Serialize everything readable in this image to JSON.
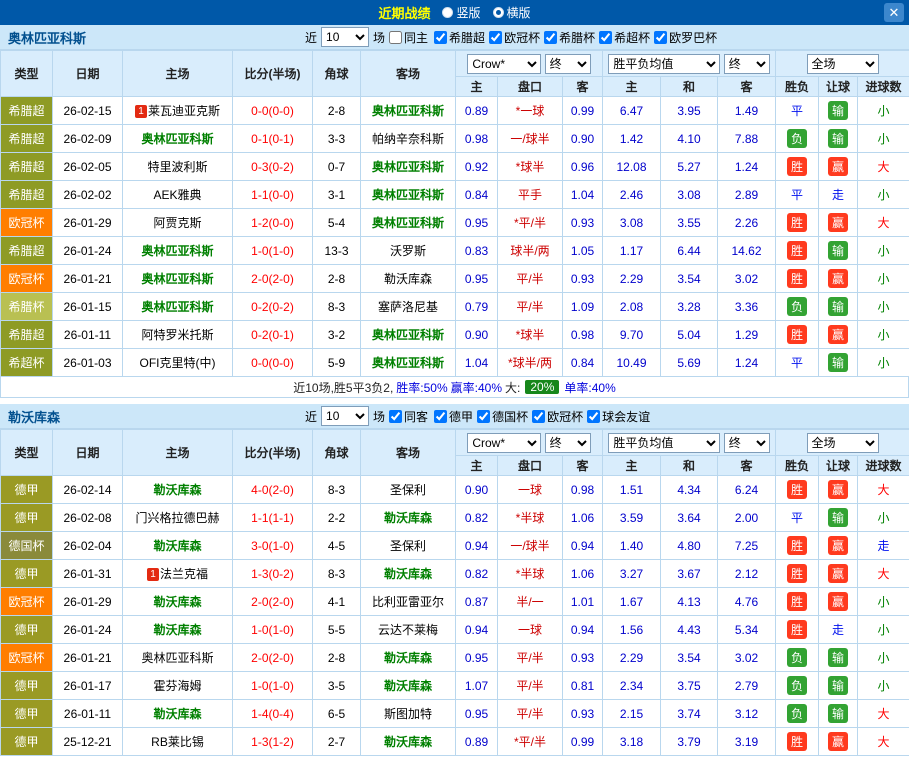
{
  "topbar": {
    "title": "近期战绩",
    "radios": [
      {
        "label": "竖版",
        "checked": false
      },
      {
        "label": "横版",
        "checked": true
      }
    ],
    "close_label": "✕"
  },
  "table_header": {
    "type": "类型",
    "date": "日期",
    "home": "主场",
    "score": "比分(半场)",
    "corner": "角球",
    "away": "客场",
    "asian_home": "主",
    "asian_line": "盘口",
    "asian_away": "客",
    "euro_home": "主",
    "euro_draw": "和",
    "euro_away": "客",
    "result": "胜负",
    "handicap": "让球",
    "goals": "进球数"
  },
  "league_colors": {
    "希腊超": "#8e9b25",
    "希腊杯": "#b9c052",
    "希超杯": "#8e9b25",
    "欧冠杯": "#ff7e00",
    "德甲": "#9a9a24",
    "德国杯": "#8a8a3a"
  },
  "sections": [
    {
      "team": "奥林匹亚科斯",
      "filter": {
        "near_label": "近",
        "count": "10",
        "games_label": "场",
        "same_label": "同主",
        "same_checked": false,
        "leagues": [
          {
            "label": "希腊超",
            "checked": true
          },
          {
            "label": "欧冠杯",
            "checked": true
          },
          {
            "label": "希腊杯",
            "checked": true
          },
          {
            "label": "希超杯",
            "checked": true
          },
          {
            "label": "欧罗巴杯",
            "checked": true
          }
        ]
      },
      "dropdowns": {
        "company": "Crow*",
        "company_time": "终",
        "europe": "胜平负均值",
        "europe_time": "终",
        "scope": "全场"
      },
      "rows": [
        {
          "league": "希腊超",
          "date": "26-02-15",
          "home": "莱瓦迪亚克斯",
          "home_rank": "1",
          "score": "0-0(0-0)",
          "corner": "2-8",
          "away": "奥林匹亚科斯",
          "away_focus": true,
          "asian": {
            "home": "0.89",
            "line": "*一球",
            "away": "0.99"
          },
          "europe": {
            "home": "6.47",
            "draw": "3.95",
            "away": "1.49"
          },
          "result": {
            "text": "平",
            "type": "draw"
          },
          "handicap_result": {
            "text": "输",
            "type": "lose"
          },
          "goals": {
            "text": "小",
            "type": "small"
          }
        },
        {
          "league": "希腊超",
          "date": "26-02-09",
          "home": "奥林匹亚科斯",
          "home_focus": true,
          "score": "0-1(0-1)",
          "corner": "3-3",
          "away": "帕纳辛奈科斯",
          "asian": {
            "home": "0.98",
            "line": "一/球半",
            "away": "0.90"
          },
          "europe": {
            "home": "1.42",
            "draw": "4.10",
            "away": "7.88"
          },
          "result": {
            "text": "负",
            "type": "lose"
          },
          "handicap_result": {
            "text": "输",
            "type": "lose"
          },
          "goals": {
            "text": "小",
            "type": "small"
          }
        },
        {
          "league": "希腊超",
          "date": "26-02-05",
          "home": "特里波利斯",
          "score": "0-3(0-2)",
          "corner": "0-7",
          "away": "奥林匹亚科斯",
          "away_focus": true,
          "asian": {
            "home": "0.92",
            "line": "*球半",
            "away": "0.96"
          },
          "europe": {
            "home": "12.08",
            "draw": "5.27",
            "away": "1.24"
          },
          "result": {
            "text": "胜",
            "type": "win"
          },
          "handicap_result": {
            "text": "赢",
            "type": "win"
          },
          "goals": {
            "text": "大",
            "type": "big"
          }
        },
        {
          "league": "希腊超",
          "date": "26-02-02",
          "home": "AEK雅典",
          "score": "1-1(0-0)",
          "corner": "3-1",
          "away": "奥林匹亚科斯",
          "away_focus": true,
          "asian": {
            "home": "0.84",
            "line": "平手",
            "away": "1.04"
          },
          "europe": {
            "home": "2.46",
            "draw": "3.08",
            "away": "2.89"
          },
          "result": {
            "text": "平",
            "type": "draw"
          },
          "handicap_result": {
            "text": "走",
            "type": "push"
          },
          "goals": {
            "text": "小",
            "type": "small"
          }
        },
        {
          "league": "欧冠杯",
          "date": "26-01-29",
          "home": "阿贾克斯",
          "score": "1-2(0-0)",
          "corner": "5-4",
          "away": "奥林匹亚科斯",
          "away_focus": true,
          "asian": {
            "home": "0.95",
            "line": "*平/半",
            "away": "0.93"
          },
          "europe": {
            "home": "3.08",
            "draw": "3.55",
            "away": "2.26"
          },
          "result": {
            "text": "胜",
            "type": "win"
          },
          "handicap_result": {
            "text": "赢",
            "type": "win"
          },
          "goals": {
            "text": "大",
            "type": "big"
          }
        },
        {
          "league": "希腊超",
          "date": "26-01-24",
          "home": "奥林匹亚科斯",
          "home_focus": true,
          "score": "1-0(1-0)",
          "corner": "13-3",
          "away": "沃罗斯",
          "asian": {
            "home": "0.83",
            "line": "球半/两",
            "away": "1.05"
          },
          "europe": {
            "home": "1.17",
            "draw": "6.44",
            "away": "14.62"
          },
          "result": {
            "text": "胜",
            "type": "win"
          },
          "handicap_result": {
            "text": "输",
            "type": "lose"
          },
          "goals": {
            "text": "小",
            "type": "small"
          }
        },
        {
          "league": "欧冠杯",
          "date": "26-01-21",
          "home": "奥林匹亚科斯",
          "home_focus": true,
          "score": "2-0(2-0)",
          "corner": "2-8",
          "away": "勒沃库森",
          "asian": {
            "home": "0.95",
            "line": "平/半",
            "away": "0.93"
          },
          "europe": {
            "home": "2.29",
            "draw": "3.54",
            "away": "3.02"
          },
          "result": {
            "text": "胜",
            "type": "win"
          },
          "handicap_result": {
            "text": "赢",
            "type": "win"
          },
          "goals": {
            "text": "小",
            "type": "small"
          }
        },
        {
          "league": "希腊杯",
          "date": "26-01-15",
          "home": "奥林匹亚科斯",
          "home_focus": true,
          "score": "0-2(0-2)",
          "corner": "8-3",
          "away": "塞萨洛尼基",
          "asian": {
            "home": "0.79",
            "line": "平/半",
            "away": "1.09"
          },
          "europe": {
            "home": "2.08",
            "draw": "3.28",
            "away": "3.36"
          },
          "result": {
            "text": "负",
            "type": "lose"
          },
          "handicap_result": {
            "text": "输",
            "type": "lose"
          },
          "goals": {
            "text": "小",
            "type": "small"
          }
        },
        {
          "league": "希腊超",
          "date": "26-01-11",
          "home": "阿特罗米托斯",
          "score": "0-2(0-1)",
          "corner": "3-2",
          "away": "奥林匹亚科斯",
          "away_focus": true,
          "asian": {
            "home": "0.90",
            "line": "*球半",
            "away": "0.98"
          },
          "europe": {
            "home": "9.70",
            "draw": "5.04",
            "away": "1.29"
          },
          "result": {
            "text": "胜",
            "type": "win"
          },
          "handicap_result": {
            "text": "赢",
            "type": "win"
          },
          "goals": {
            "text": "小",
            "type": "small"
          }
        },
        {
          "league": "希超杯",
          "date": "26-01-03",
          "home": "OFI克里特(中)",
          "score": "0-0(0-0)",
          "corner": "5-9",
          "away": "奥林匹亚科斯",
          "away_focus": true,
          "asian": {
            "home": "1.04",
            "line": "*球半/两",
            "away": "0.84"
          },
          "europe": {
            "home": "10.49",
            "draw": "5.69",
            "away": "1.24"
          },
          "result": {
            "text": "平",
            "type": "draw"
          },
          "handicap_result": {
            "text": "输",
            "type": "lose"
          },
          "goals": {
            "text": "小",
            "type": "small"
          }
        }
      ],
      "summary": [
        {
          "text": "近10场,胜5平3负2, ",
          "style": "plain"
        },
        {
          "text": "胜率:50%",
          "style": "blue"
        },
        {
          "text": " 赢率:40%",
          "style": "blue"
        },
        {
          "text": " 大:",
          "style": "plain"
        },
        {
          "text": "20%",
          "style": "green-badge"
        },
        {
          "text": " 单率:40%",
          "style": "blue"
        }
      ]
    },
    {
      "team": "勒沃库森",
      "filter": {
        "near_label": "近",
        "count": "10",
        "games_label": "场",
        "same_label": "同客",
        "same_checked": true,
        "leagues": [
          {
            "label": "德甲",
            "checked": true
          },
          {
            "label": "德国杯",
            "checked": true
          },
          {
            "label": "欧冠杯",
            "checked": true
          },
          {
            "label": "球会友谊",
            "checked": true
          }
        ]
      },
      "dropdowns": {
        "company": "Crow*",
        "company_time": "终",
        "europe": "胜平负均值",
        "europe_time": "终",
        "scope": "全场"
      },
      "rows": [
        {
          "league": "德甲",
          "date": "26-02-14",
          "home": "勒沃库森",
          "home_focus": true,
          "score": "4-0(2-0)",
          "corner": "8-3",
          "away": "圣保利",
          "asian": {
            "home": "0.90",
            "line": "一球",
            "away": "0.98"
          },
          "europe": {
            "home": "1.51",
            "draw": "4.34",
            "away": "6.24"
          },
          "result": {
            "text": "胜",
            "type": "win"
          },
          "handicap_result": {
            "text": "赢",
            "type": "win"
          },
          "goals": {
            "text": "大",
            "type": "big"
          }
        },
        {
          "league": "德甲",
          "date": "26-02-08",
          "home": "门兴格拉德巴赫",
          "score": "1-1(1-1)",
          "corner": "2-2",
          "away": "勒沃库森",
          "away_focus": true,
          "asian": {
            "home": "0.82",
            "line": "*半球",
            "away": "1.06"
          },
          "europe": {
            "home": "3.59",
            "draw": "3.64",
            "away": "2.00"
          },
          "result": {
            "text": "平",
            "type": "draw"
          },
          "handicap_result": {
            "text": "输",
            "type": "lose"
          },
          "goals": {
            "text": "小",
            "type": "small"
          }
        },
        {
          "league": "德国杯",
          "date": "26-02-04",
          "home": "勒沃库森",
          "home_focus": true,
          "score": "3-0(1-0)",
          "corner": "4-5",
          "away": "圣保利",
          "asian": {
            "home": "0.94",
            "line": "一/球半",
            "away": "0.94"
          },
          "europe": {
            "home": "1.40",
            "draw": "4.80",
            "away": "7.25"
          },
          "result": {
            "text": "胜",
            "type": "win"
          },
          "handicap_result": {
            "text": "赢",
            "type": "win"
          },
          "goals": {
            "text": "走",
            "type": "push"
          }
        },
        {
          "league": "德甲",
          "date": "26-01-31",
          "home": "法兰克福",
          "home_rank": "1",
          "score": "1-3(0-2)",
          "corner": "8-3",
          "away": "勒沃库森",
          "away_focus": true,
          "asian": {
            "home": "0.82",
            "line": "*半球",
            "away": "1.06"
          },
          "europe": {
            "home": "3.27",
            "draw": "3.67",
            "away": "2.12"
          },
          "result": {
            "text": "胜",
            "type": "win"
          },
          "handicap_result": {
            "text": "赢",
            "type": "win"
          },
          "goals": {
            "text": "大",
            "type": "big"
          }
        },
        {
          "league": "欧冠杯",
          "date": "26-01-29",
          "home": "勒沃库森",
          "home_focus": true,
          "score": "2-0(2-0)",
          "corner": "4-1",
          "away": "比利亚雷亚尔",
          "asian": {
            "home": "0.87",
            "line": "半/一",
            "away": "1.01"
          },
          "europe": {
            "home": "1.67",
            "draw": "4.13",
            "away": "4.76"
          },
          "result": {
            "text": "胜",
            "type": "win"
          },
          "handicap_result": {
            "text": "赢",
            "type": "win"
          },
          "goals": {
            "text": "小",
            "type": "small"
          }
        },
        {
          "league": "德甲",
          "date": "26-01-24",
          "home": "勒沃库森",
          "home_focus": true,
          "score": "1-0(1-0)",
          "corner": "5-5",
          "away": "云达不莱梅",
          "asian": {
            "home": "0.94",
            "line": "一球",
            "away": "0.94"
          },
          "europe": {
            "home": "1.56",
            "draw": "4.43",
            "away": "5.34"
          },
          "result": {
            "text": "胜",
            "type": "win"
          },
          "handicap_result": {
            "text": "走",
            "type": "push"
          },
          "goals": {
            "text": "小",
            "type": "small"
          }
        },
        {
          "league": "欧冠杯",
          "date": "26-01-21",
          "home": "奥林匹亚科斯",
          "score": "2-0(2-0)",
          "corner": "2-8",
          "away": "勒沃库森",
          "away_focus": true,
          "asian": {
            "home": "0.95",
            "line": "平/半",
            "away": "0.93"
          },
          "europe": {
            "home": "2.29",
            "draw": "3.54",
            "away": "3.02"
          },
          "result": {
            "text": "负",
            "type": "lose"
          },
          "handicap_result": {
            "text": "输",
            "type": "lose"
          },
          "goals": {
            "text": "小",
            "type": "small"
          }
        },
        {
          "league": "德甲",
          "date": "26-01-17",
          "home": "霍芬海姆",
          "score": "1-0(1-0)",
          "corner": "3-5",
          "away": "勒沃库森",
          "away_focus": true,
          "asian": {
            "home": "1.07",
            "line": "平/半",
            "away": "0.81"
          },
          "europe": {
            "home": "2.34",
            "draw": "3.75",
            "away": "2.79"
          },
          "result": {
            "text": "负",
            "type": "lose"
          },
          "handicap_result": {
            "text": "输",
            "type": "lose"
          },
          "goals": {
            "text": "小",
            "type": "small"
          }
        },
        {
          "league": "德甲",
          "date": "26-01-11",
          "home": "勒沃库森",
          "home_focus": true,
          "score": "1-4(0-4)",
          "corner": "6-5",
          "away": "斯图加特",
          "asian": {
            "home": "0.95",
            "line": "平/半",
            "away": "0.93"
          },
          "europe": {
            "home": "2.15",
            "draw": "3.74",
            "away": "3.12"
          },
          "result": {
            "text": "负",
            "type": "lose"
          },
          "handicap_result": {
            "text": "输",
            "type": "lose"
          },
          "goals": {
            "text": "大",
            "type": "big"
          }
        },
        {
          "league": "德甲",
          "date": "25-12-21",
          "home": "RB莱比锡",
          "score": "1-3(1-2)",
          "corner": "2-7",
          "away": "勒沃库森",
          "away_focus": true,
          "asian": {
            "home": "0.89",
            "line": "*平/半",
            "away": "0.99"
          },
          "europe": {
            "home": "3.18",
            "draw": "3.79",
            "away": "3.19"
          },
          "result": {
            "text": "胜",
            "type": "win"
          },
          "handicap_result": {
            "text": "赢",
            "type": "win"
          },
          "goals": {
            "text": "大",
            "type": "big"
          }
        }
      ],
      "summary": null
    }
  ]
}
